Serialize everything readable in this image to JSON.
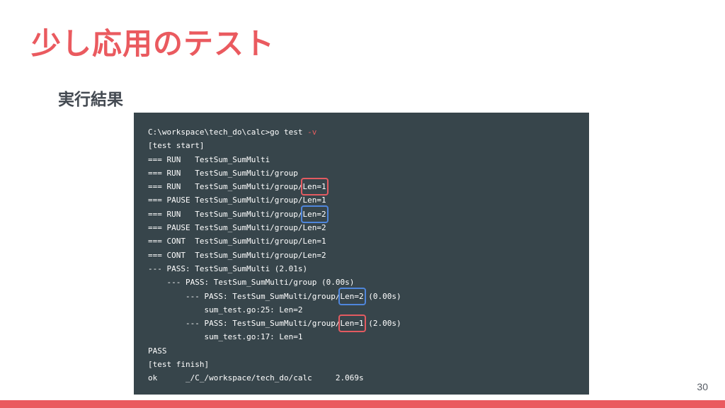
{
  "slide": {
    "title": "少し応用のテスト",
    "subtitle": "実行結果",
    "page_number": "30",
    "colors": {
      "accent": "#ea5a5f",
      "terminal_bg": "#37454b",
      "highlight_red": "#e35b61",
      "highlight_blue": "#4f86db"
    }
  },
  "terminal": {
    "prompt_command": "C:\\workspace\\tech_do\\calc>go test ",
    "prompt_flag": "-v",
    "lines": [
      "[test start]",
      "=== RUN   TestSum_SumMulti",
      "=== RUN   TestSum_SumMulti/group",
      "=== RUN   TestSum_SumMulti/group",
      "Len=1",
      "=== PAUSE TestSum_SumMulti/group/Len=1",
      "=== RUN   TestSum_SumMulti/group",
      "Len=2",
      "=== PAUSE TestSum_SumMulti/group/Len=2",
      "=== CONT  TestSum_SumMulti/group/Len=1",
      "=== CONT  TestSum_SumMulti/group/Len=2",
      "--- PASS: TestSum_SumMulti (2.01s)",
      "    --- PASS: TestSum_SumMulti/group (0.00s)",
      "        --- PASS: TestSum_SumMulti/group",
      "Len=2",
      " (0.00s)",
      "            sum_test.go:25: Len=2",
      "        --- PASS: TestSum_SumMulti/group",
      "Len=1",
      " (2.00s)",
      "            sum_test.go:17: Len=1",
      "PASS",
      "[test finish]",
      "ok      _/C_/workspace/tech_do/calc     2.069s"
    ]
  }
}
